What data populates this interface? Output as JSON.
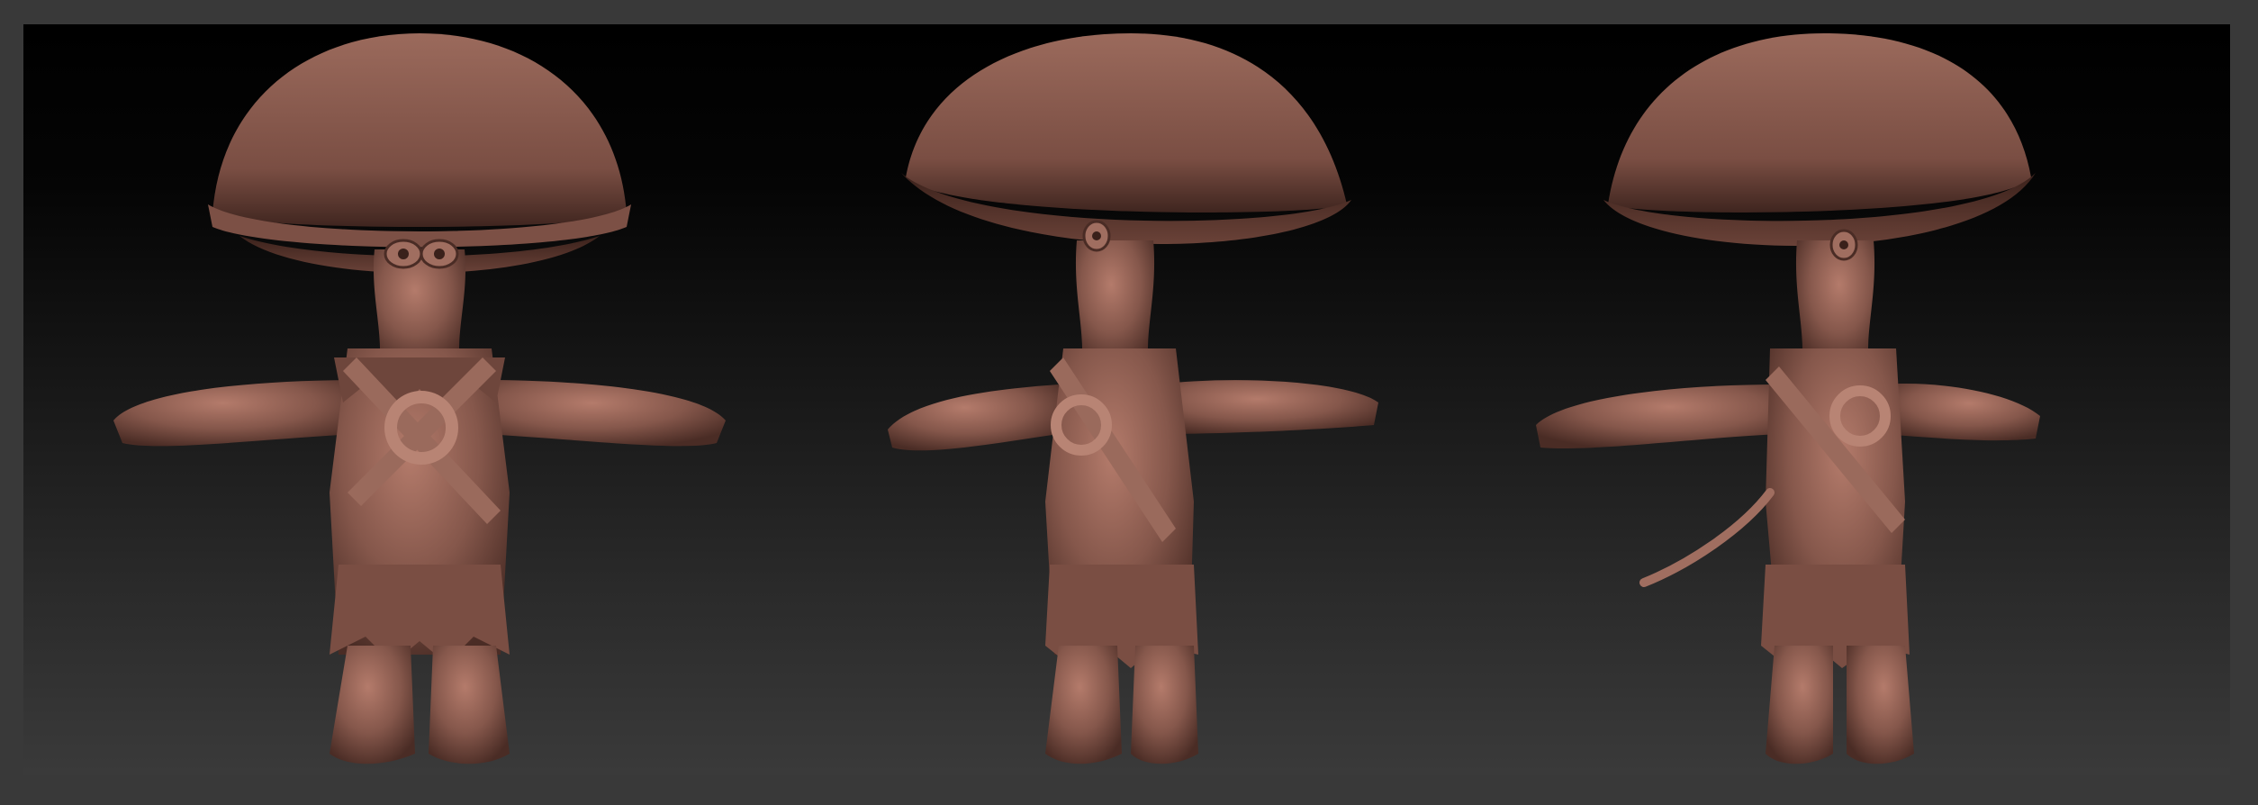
{
  "scene": {
    "colors": {
      "frame": "#393939",
      "viewport_top": "#000000",
      "viewport_bottom": "#3a3a3a",
      "clay": "#8a5a4e",
      "clay_light": "#b07868",
      "clay_dark": "#4a2c25"
    },
    "figures": [
      {
        "view": "front"
      },
      {
        "view": "three-quarter-left"
      },
      {
        "view": "three-quarter-right"
      }
    ]
  }
}
